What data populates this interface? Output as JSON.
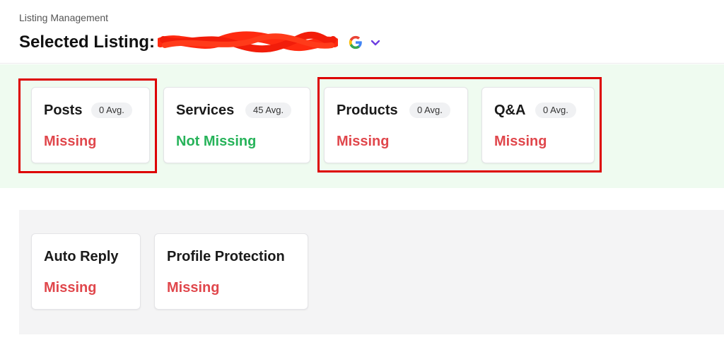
{
  "header": {
    "breadcrumb": "Listing Management",
    "title": "Selected Listing:"
  },
  "icons": {
    "google": "google-g-icon",
    "dropdown": "chevron-down-icon"
  },
  "colors": {
    "missing": "#e0474c",
    "not_missing": "#27b35a",
    "highlight": "#dd0000",
    "panel_green": "#effbf0",
    "panel_gray": "#f4f4f5",
    "chevron": "#6d3ee0"
  },
  "top_cards": [
    {
      "title": "Posts",
      "avg": "0 Avg.",
      "status": "Missing",
      "state": "missing"
    },
    {
      "title": "Services",
      "avg": "45 Avg.",
      "status": "Not Missing",
      "state": "not_missing"
    },
    {
      "title": "Products",
      "avg": "0 Avg.",
      "status": "Missing",
      "state": "missing"
    },
    {
      "title": "Q&A",
      "avg": "0 Avg.",
      "status": "Missing",
      "state": "missing"
    }
  ],
  "bottom_cards": [
    {
      "title": "Auto Reply",
      "status": "Missing",
      "state": "missing"
    },
    {
      "title": "Profile Protection",
      "status": "Missing",
      "state": "missing"
    }
  ]
}
